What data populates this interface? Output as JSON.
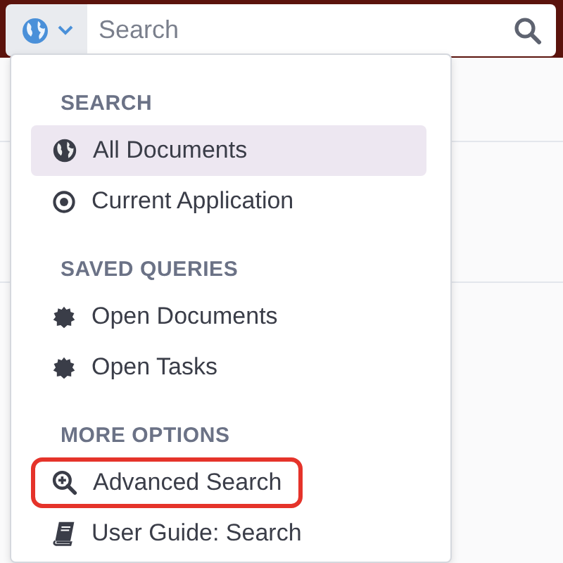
{
  "search_bar": {
    "placeholder": "Search"
  },
  "menu": {
    "sections": [
      {
        "heading": "SEARCH",
        "items": [
          {
            "label": "All Documents",
            "selected": true,
            "highlighted": false
          },
          {
            "label": "Current Application",
            "selected": false,
            "highlighted": false
          }
        ]
      },
      {
        "heading": "SAVED QUERIES",
        "items": [
          {
            "label": "Open Documents",
            "selected": false,
            "highlighted": false
          },
          {
            "label": "Open Tasks",
            "selected": false,
            "highlighted": false
          }
        ]
      },
      {
        "heading": "MORE OPTIONS",
        "items": [
          {
            "label": "Advanced Search",
            "selected": false,
            "highlighted": true
          },
          {
            "label": "User Guide: Search",
            "selected": false,
            "highlighted": false
          }
        ]
      }
    ]
  }
}
